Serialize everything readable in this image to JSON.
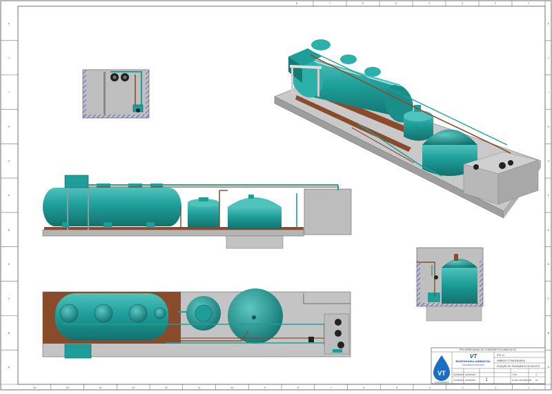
{
  "colors": {
    "tank": "#1e9e9a",
    "tank_dark": "#147a76",
    "tank_light": "#5cc7c2",
    "pipe": "#8a4b2a",
    "slab": "#c9c9c9",
    "slab_dark": "#9a9a9a",
    "hatch": "#3a3fd0",
    "frame": "#6e6e6e",
    "logo": "#1b4e9e"
  },
  "frame": {
    "top_numbers": [
      "8",
      "7",
      "6",
      "5",
      "4",
      "3",
      "2",
      "1"
    ],
    "bottom_numbers": [
      "16",
      "15",
      "14",
      "13",
      "12",
      "11",
      "10",
      "9",
      "8",
      "7",
      "6",
      "5",
      "4",
      "3",
      "2",
      "1"
    ],
    "left_letters": [
      "K",
      "J",
      "I",
      "H",
      "G",
      "F",
      "E",
      "D",
      "C",
      "B",
      "A"
    ],
    "right_letters": [
      "K",
      "J",
      "I",
      "H",
      "G",
      "F",
      "E",
      "D",
      "C",
      "B",
      "A"
    ]
  },
  "title_block": {
    "project_line": "PRO ARREDANDO DO CONSUMO FICA 5x6A 26 KG",
    "logo_letters": "VT",
    "company": "ENGENHARIA AMBIENTAL",
    "company_sub": "TRATAMENTO SANITÁRIO",
    "logo_caption": "VT ENGENHARIA",
    "right_header": "ETE 14",
    "client": "FABRIDO VT ENGENHARIA",
    "title": "ESTAÇÃO DE TRATAMENTO DE ESGOTO",
    "cells": [
      "01/06/2023",
      "01/06/2023",
      "01/06/2023",
      "01/06/2023"
    ],
    "sheet": "1",
    "scale": "1:50",
    "drawing_no": "E-14/01-000-0000-000",
    "rev": "A",
    "size": "A3"
  }
}
